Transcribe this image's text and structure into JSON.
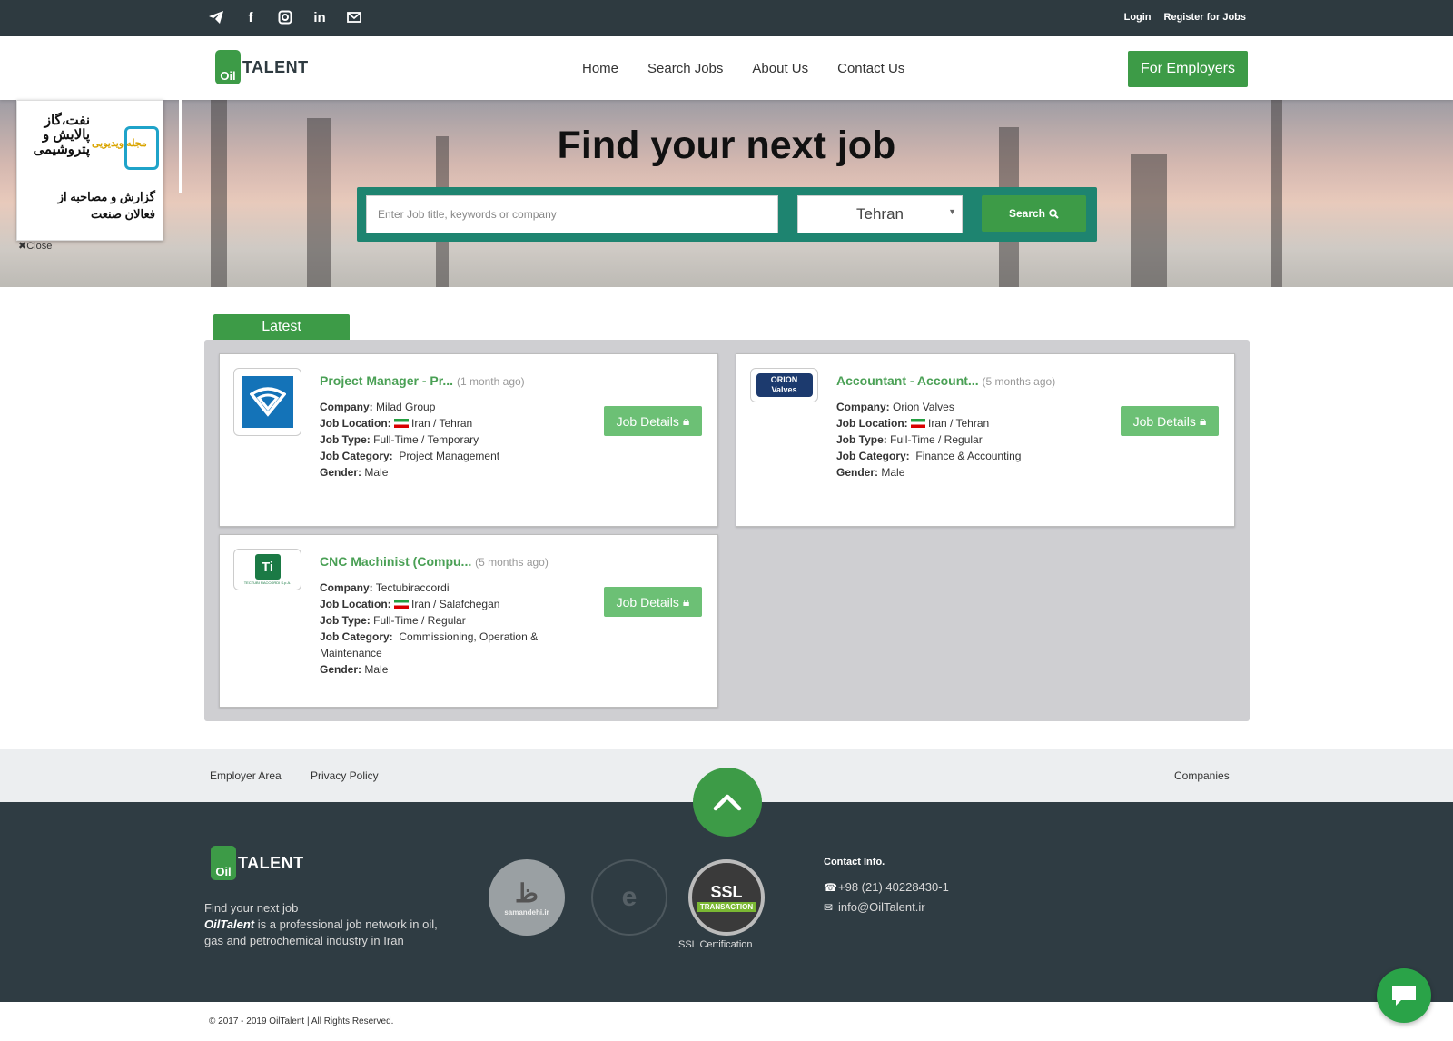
{
  "topbar": {
    "social_icons": [
      "telegram-icon",
      "facebook-icon",
      "instagram-icon",
      "linkedin-icon",
      "mail-icon"
    ],
    "login": "Login",
    "register": "Register for Jobs"
  },
  "brand": {
    "logo_badge": "Oil",
    "logo_text": "TALENT",
    "accent": "#3d9b47",
    "dark": "#2e3a40"
  },
  "nav": {
    "items": [
      "Home",
      "Search Jobs",
      "About Us",
      "Contact Us"
    ],
    "employers": "For Employers"
  },
  "hero": {
    "title": "Find your next job",
    "search_placeholder": "Enter Job title, keywords or company",
    "location": "Tehran",
    "search_button": "Search"
  },
  "ad": {
    "title": "نفت،گاز پالایش و پتروشیمی",
    "tag": "مجله ویدیویی",
    "sub": "گزارش و مصاحبه از فعالان صنعت",
    "close": "Close"
  },
  "latest": {
    "tab": "Latest",
    "details_label": "Job Details",
    "labels": {
      "company": "Company:",
      "location": "Job Location:",
      "type": "Job Type:",
      "category": "Job Category:",
      "gender": "Gender:"
    },
    "jobs": [
      {
        "title": "Project Manager - Pr...",
        "ago": "(1 month ago)",
        "company": "Milad Group",
        "location": "Iran / Tehran",
        "type": "Full-Time / Temporary",
        "category": "Project Management",
        "gender": "Male"
      },
      {
        "title": "Accountant - Account...",
        "ago": "(5 months ago)",
        "company": "Orion Valves",
        "location": "Iran / Tehran",
        "type": "Full-Time / Regular",
        "category": "Finance & Accounting",
        "gender": "Male",
        "logo_text1": "ORION",
        "logo_text2": "Valves"
      },
      {
        "title": "CNC Machinist (Compu...",
        "ago": "(5 months ago)",
        "company": "Tectubiraccordi",
        "location": "Iran / Salafchegan",
        "type": "Full-Time / Regular",
        "category": "Commissioning, Operation & Maintenance",
        "gender": "Male",
        "logo_text1": "Ti",
        "logo_text2": "TECTUBI RACCORDI S.p.A."
      }
    ]
  },
  "footer_links": {
    "employer": "Employer Area",
    "privacy": "Privacy Policy",
    "companies": "Companies"
  },
  "footer": {
    "tagline": "Find your next job",
    "brand_name": "OilTalent",
    "desc": " is a professional job network in oil, gas and petrochemical industry in Iran",
    "seal1": "samandehi.ir",
    "ssl_text": "SSL",
    "ssl_sub": "TRANSACTION",
    "ssl_caption": "SSL Certification",
    "contact_title": "Contact Info.",
    "phone": "+98 (21) 40228430-1",
    "email": "info@OilTalent.ir",
    "copyright": "© 2017 - 2019 OilTalent | All Rights Reserved."
  }
}
